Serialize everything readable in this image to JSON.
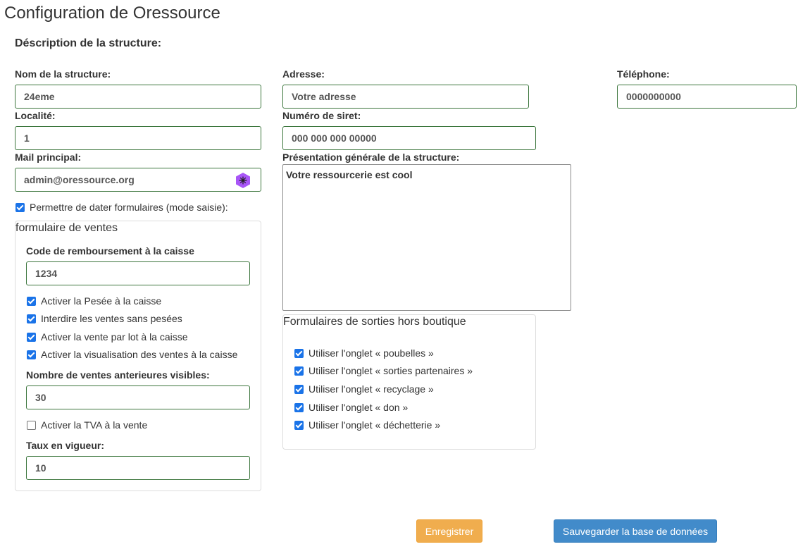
{
  "page": {
    "title": "Configuration de Oressource"
  },
  "structure": {
    "section_title": "Déscription de la structure:",
    "nom_label": "Nom de la structure:",
    "nom_value": "24eme",
    "adresse_label": "Adresse:",
    "adresse_value": "Votre adresse",
    "telephone_label": "Téléphone:",
    "telephone_value": "0000000000",
    "localite_label": "Localité:",
    "localite_value": "1",
    "siret_label": "Numéro de siret:",
    "siret_value": "000 000 000 00000",
    "mail_label": "Mail principal:",
    "mail_value": "admin@oressource.org",
    "presentation_label": "Présentation générale de la structure:",
    "presentation_value": "Votre ressourcerie est cool",
    "dater_label": "Permettre de dater formulaires (mode saisie):",
    "dater_checked": true
  },
  "ventes": {
    "legend": "formulaire de ventes",
    "code_label": "Code de remboursement à la caisse",
    "code_value": "1234",
    "options": [
      {
        "label": "Activer la Pesée à la caisse",
        "checked": true
      },
      {
        "label": "Interdire les ventes sans pesées",
        "checked": true
      },
      {
        "label": "Activer la vente par lot à la caisse",
        "checked": true
      },
      {
        "label": "Activer la visualisation des ventes à la caisse",
        "checked": true
      }
    ],
    "nombre_label": "Nombre de ventes anterieures visibles:",
    "nombre_value": "30",
    "tva_label": "Activer la TVA à la vente",
    "tva_checked": false,
    "taux_label": "Taux en vigueur:",
    "taux_value": "10"
  },
  "sorties": {
    "legend": "Formulaires de sorties hors boutique",
    "options": [
      {
        "label": "Utiliser l'onglet « poubelles »",
        "checked": true
      },
      {
        "label": "Utiliser l'onglet « sorties partenaires »",
        "checked": true
      },
      {
        "label": "Utiliser l'onglet « recyclage »",
        "checked": true
      },
      {
        "label": "Utiliser l'onglet « don »",
        "checked": true
      },
      {
        "label": "Utiliser l'onglet « déchetterie »",
        "checked": true
      }
    ]
  },
  "actions": {
    "save_label": "Enregistrer",
    "backup_label": "Sauvegarder la base de données"
  },
  "colors": {
    "valid_border": "#3c763d",
    "checkbox": "#1a73e8",
    "warning": "#f0ad4e",
    "primary": "#428bca",
    "password_icon": "#a855f7"
  }
}
